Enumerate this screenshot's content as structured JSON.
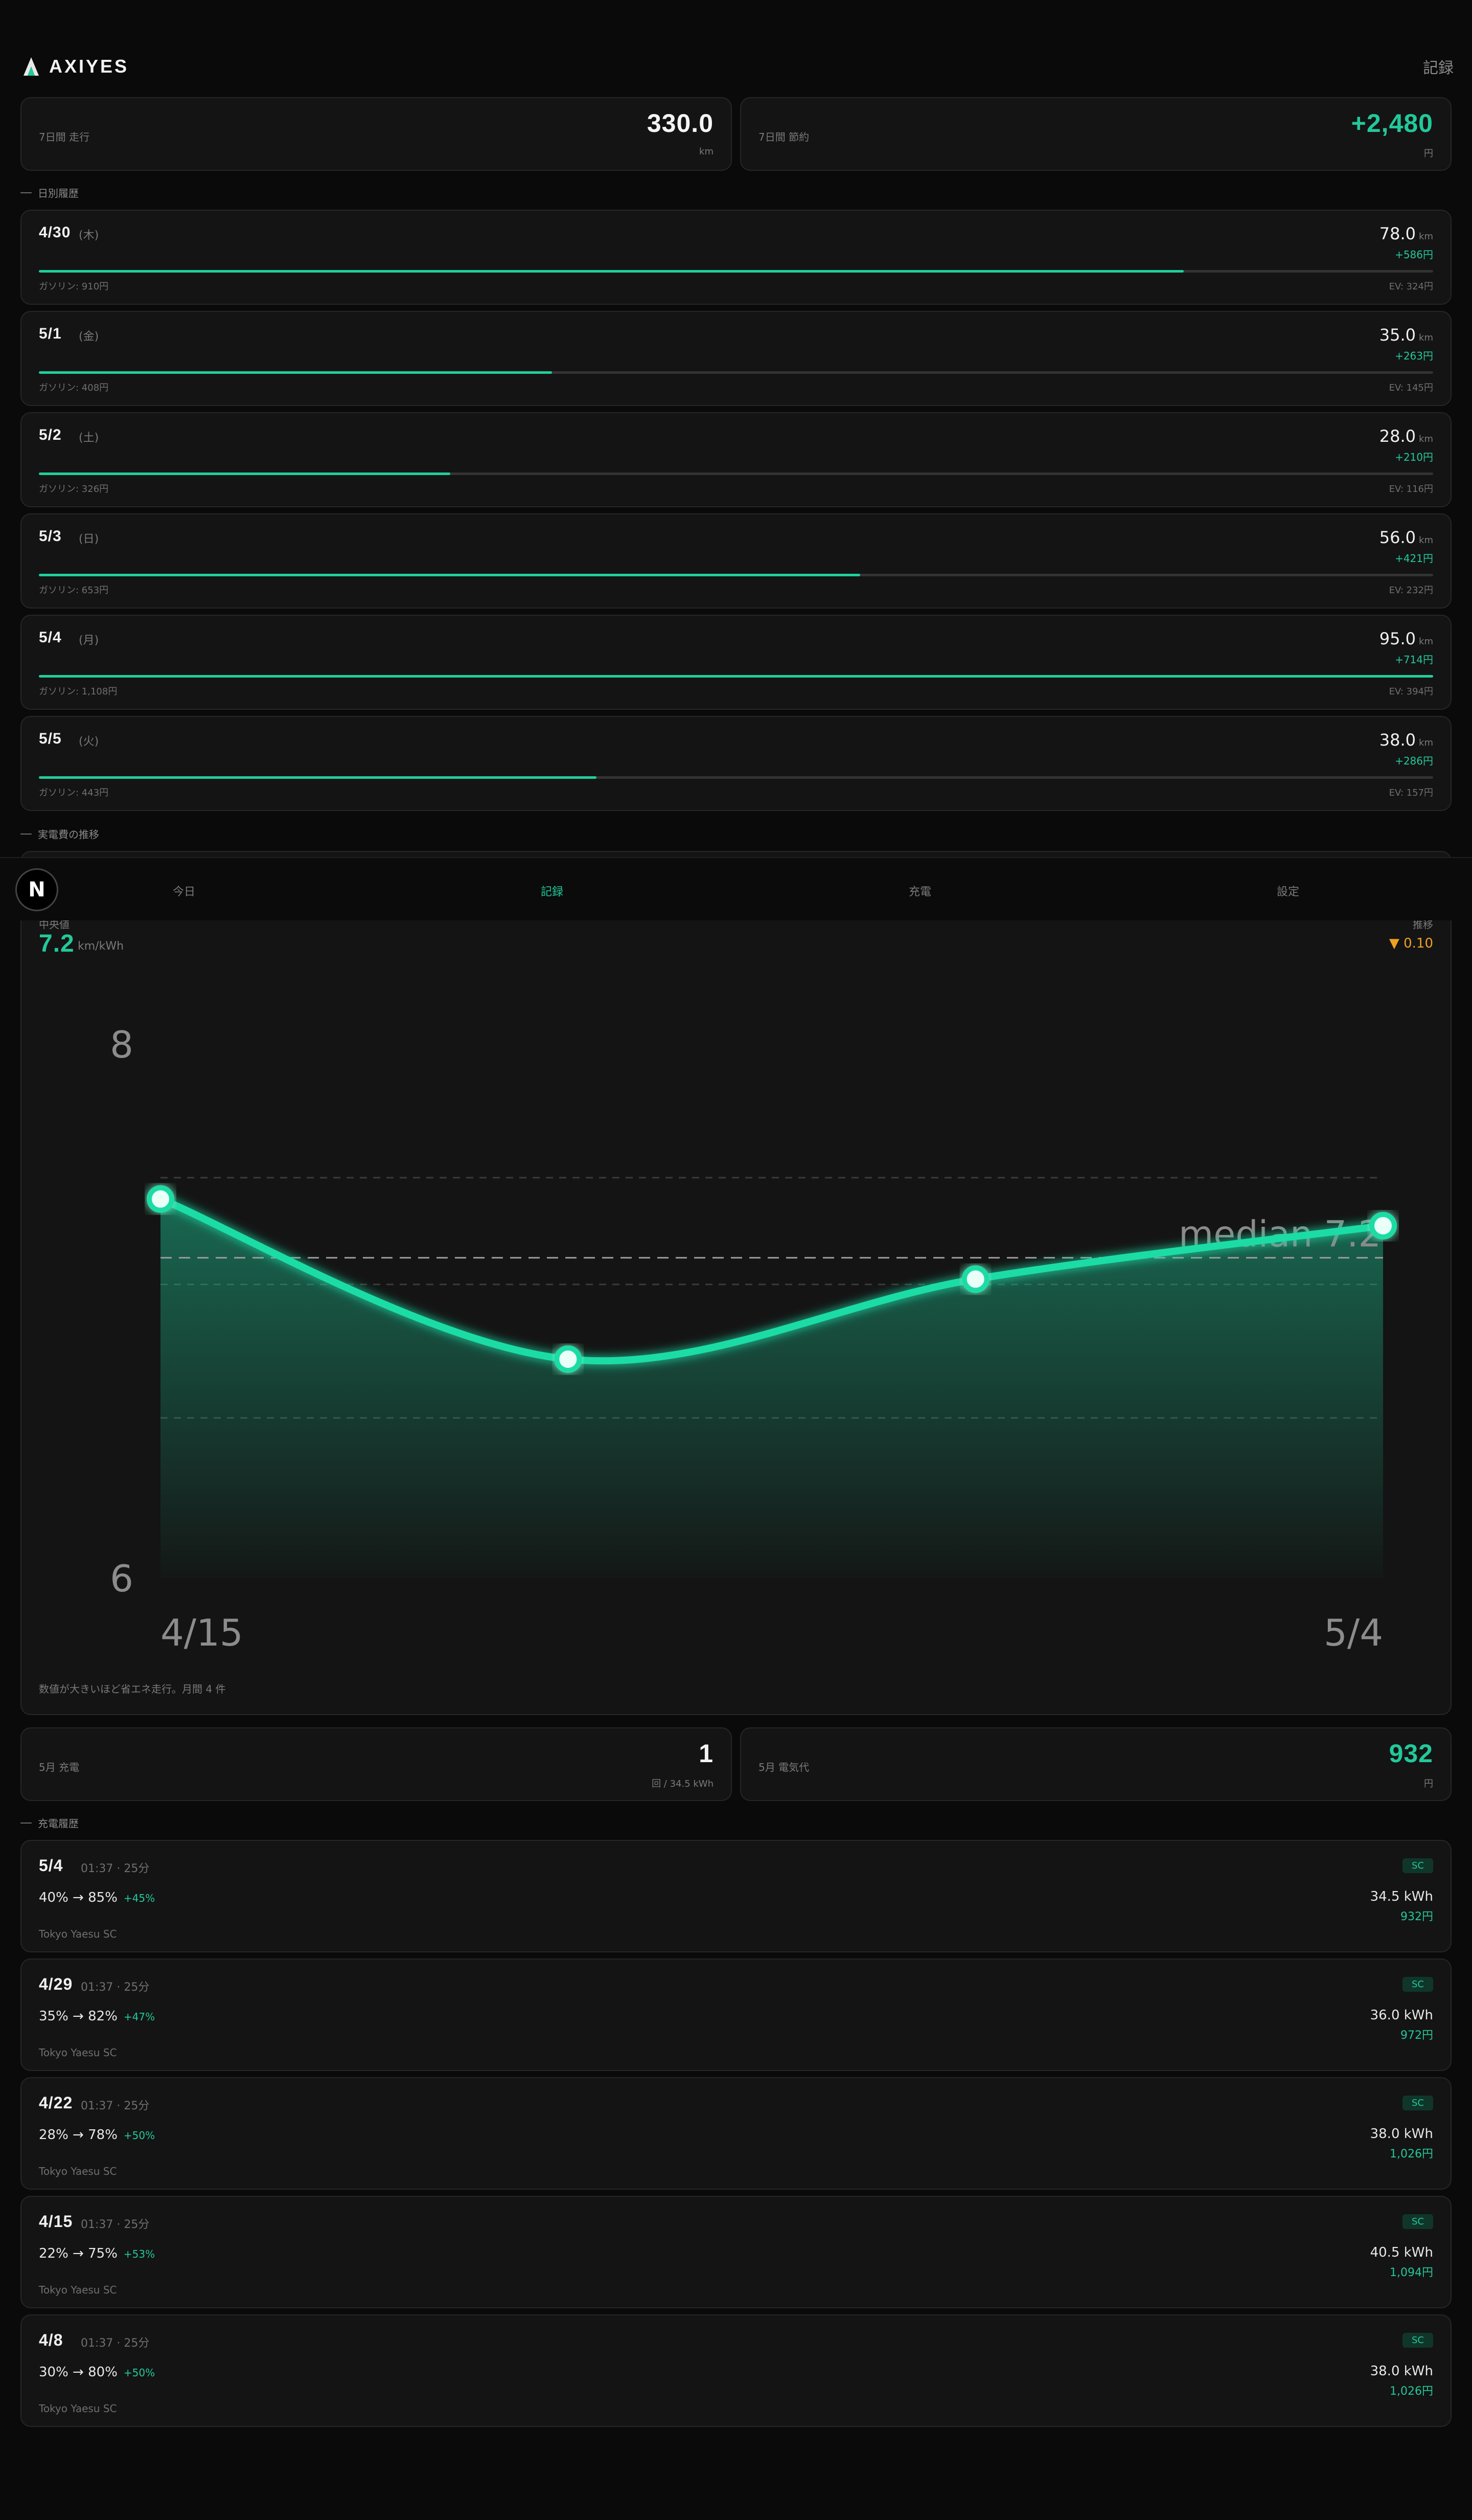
{
  "header": {
    "brand": "AXIYES",
    "page_label": "記録"
  },
  "summary": {
    "distance": {
      "label": "7日間 走行",
      "value": "330.0",
      "unit": "km"
    },
    "savings": {
      "label": "7日間 節約",
      "value": "+2,480",
      "unit": "円"
    }
  },
  "daily_section_title": "日別履歴",
  "days": [
    {
      "date": "4/30",
      "dow": "(木)",
      "km": "78.0",
      "unit": "km",
      "save": "+586円",
      "gas": "ガソリン: 910円",
      "ev": "EV: 324円",
      "ratio": 0.821
    },
    {
      "date": "5/1",
      "dow": "(金)",
      "km": "35.0",
      "unit": "km",
      "save": "+263円",
      "gas": "ガソリン: 408円",
      "ev": "EV: 145円",
      "ratio": 0.368
    },
    {
      "date": "5/2",
      "dow": "(土)",
      "km": "28.0",
      "unit": "km",
      "save": "+210円",
      "gas": "ガソリン: 326円",
      "ev": "EV: 116円",
      "ratio": 0.295
    },
    {
      "date": "5/3",
      "dow": "(日)",
      "km": "56.0",
      "unit": "km",
      "save": "+421円",
      "gas": "ガソリン: 653円",
      "ev": "EV: 232円",
      "ratio": 0.589
    },
    {
      "date": "5/4",
      "dow": "(月)",
      "km": "95.0",
      "unit": "km",
      "save": "+714円",
      "gas": "ガソリン: 1,108円",
      "ev": "EV: 394円",
      "ratio": 1.0
    },
    {
      "date": "5/5",
      "dow": "(火)",
      "km": "38.0",
      "unit": "km",
      "save": "+286円",
      "gas": "ガソリン: 443円",
      "ev": "EV: 157円",
      "ratio": 0.4
    }
  ],
  "efficiency_section_title": "実電費の推移",
  "nav": {
    "logo": "N",
    "items": [
      "今日",
      "記録",
      "充電",
      "設定"
    ],
    "active": 1
  },
  "efficiency": {
    "median_label": "中央値",
    "median_value": "7.2",
    "median_unit": "km/kWh",
    "change_label": "推移",
    "change_value": "▼ 0.10",
    "note": "数値が大きいほど省エネ走行。月間 4 件"
  },
  "chart_data": {
    "type": "area",
    "x": [
      "4/15",
      "4/22",
      "4/29",
      "5/4"
    ],
    "values": [
      7.42,
      6.82,
      7.12,
      7.32
    ],
    "median": 7.2,
    "median_label": "median 7.2",
    "ylim": [
      6,
      8
    ],
    "y_ticks": [
      "8",
      "6"
    ],
    "x_tick_labels": [
      "4/15",
      "5/4"
    ],
    "grid": true,
    "color": "#1fcf9c"
  },
  "monthly": {
    "charges": {
      "label": "5月 充電",
      "value": "1",
      "unit": "回 / 34.5 kWh"
    },
    "cost": {
      "label": "5月 電気代",
      "value": "932",
      "unit": "円"
    }
  },
  "charge_section_title": "充電履歴",
  "charges": [
    {
      "date": "5/4",
      "time": "01:37 · 25分",
      "pct": "40% → 85%",
      "delta": "+45%",
      "loc": "Tokyo Yaesu SC",
      "badge": "SC",
      "kwh": "34.5 kWh",
      "yen": "932円"
    },
    {
      "date": "4/29",
      "time": "01:37 · 25分",
      "pct": "35% → 82%",
      "delta": "+47%",
      "loc": "Tokyo Yaesu SC",
      "badge": "SC",
      "kwh": "36.0 kWh",
      "yen": "972円"
    },
    {
      "date": "4/22",
      "time": "01:37 · 25分",
      "pct": "28% → 78%",
      "delta": "+50%",
      "loc": "Tokyo Yaesu SC",
      "badge": "SC",
      "kwh": "38.0 kWh",
      "yen": "1,026円"
    },
    {
      "date": "4/15",
      "time": "01:37 · 25分",
      "pct": "22% → 75%",
      "delta": "+53%",
      "loc": "Tokyo Yaesu SC",
      "badge": "SC",
      "kwh": "40.5 kWh",
      "yen": "1,094円"
    },
    {
      "date": "4/8",
      "time": "01:37 · 25分",
      "pct": "30% → 80%",
      "delta": "+50%",
      "loc": "Tokyo Yaesu SC",
      "badge": "SC",
      "kwh": "38.0 kWh",
      "yen": "1,026円"
    }
  ]
}
